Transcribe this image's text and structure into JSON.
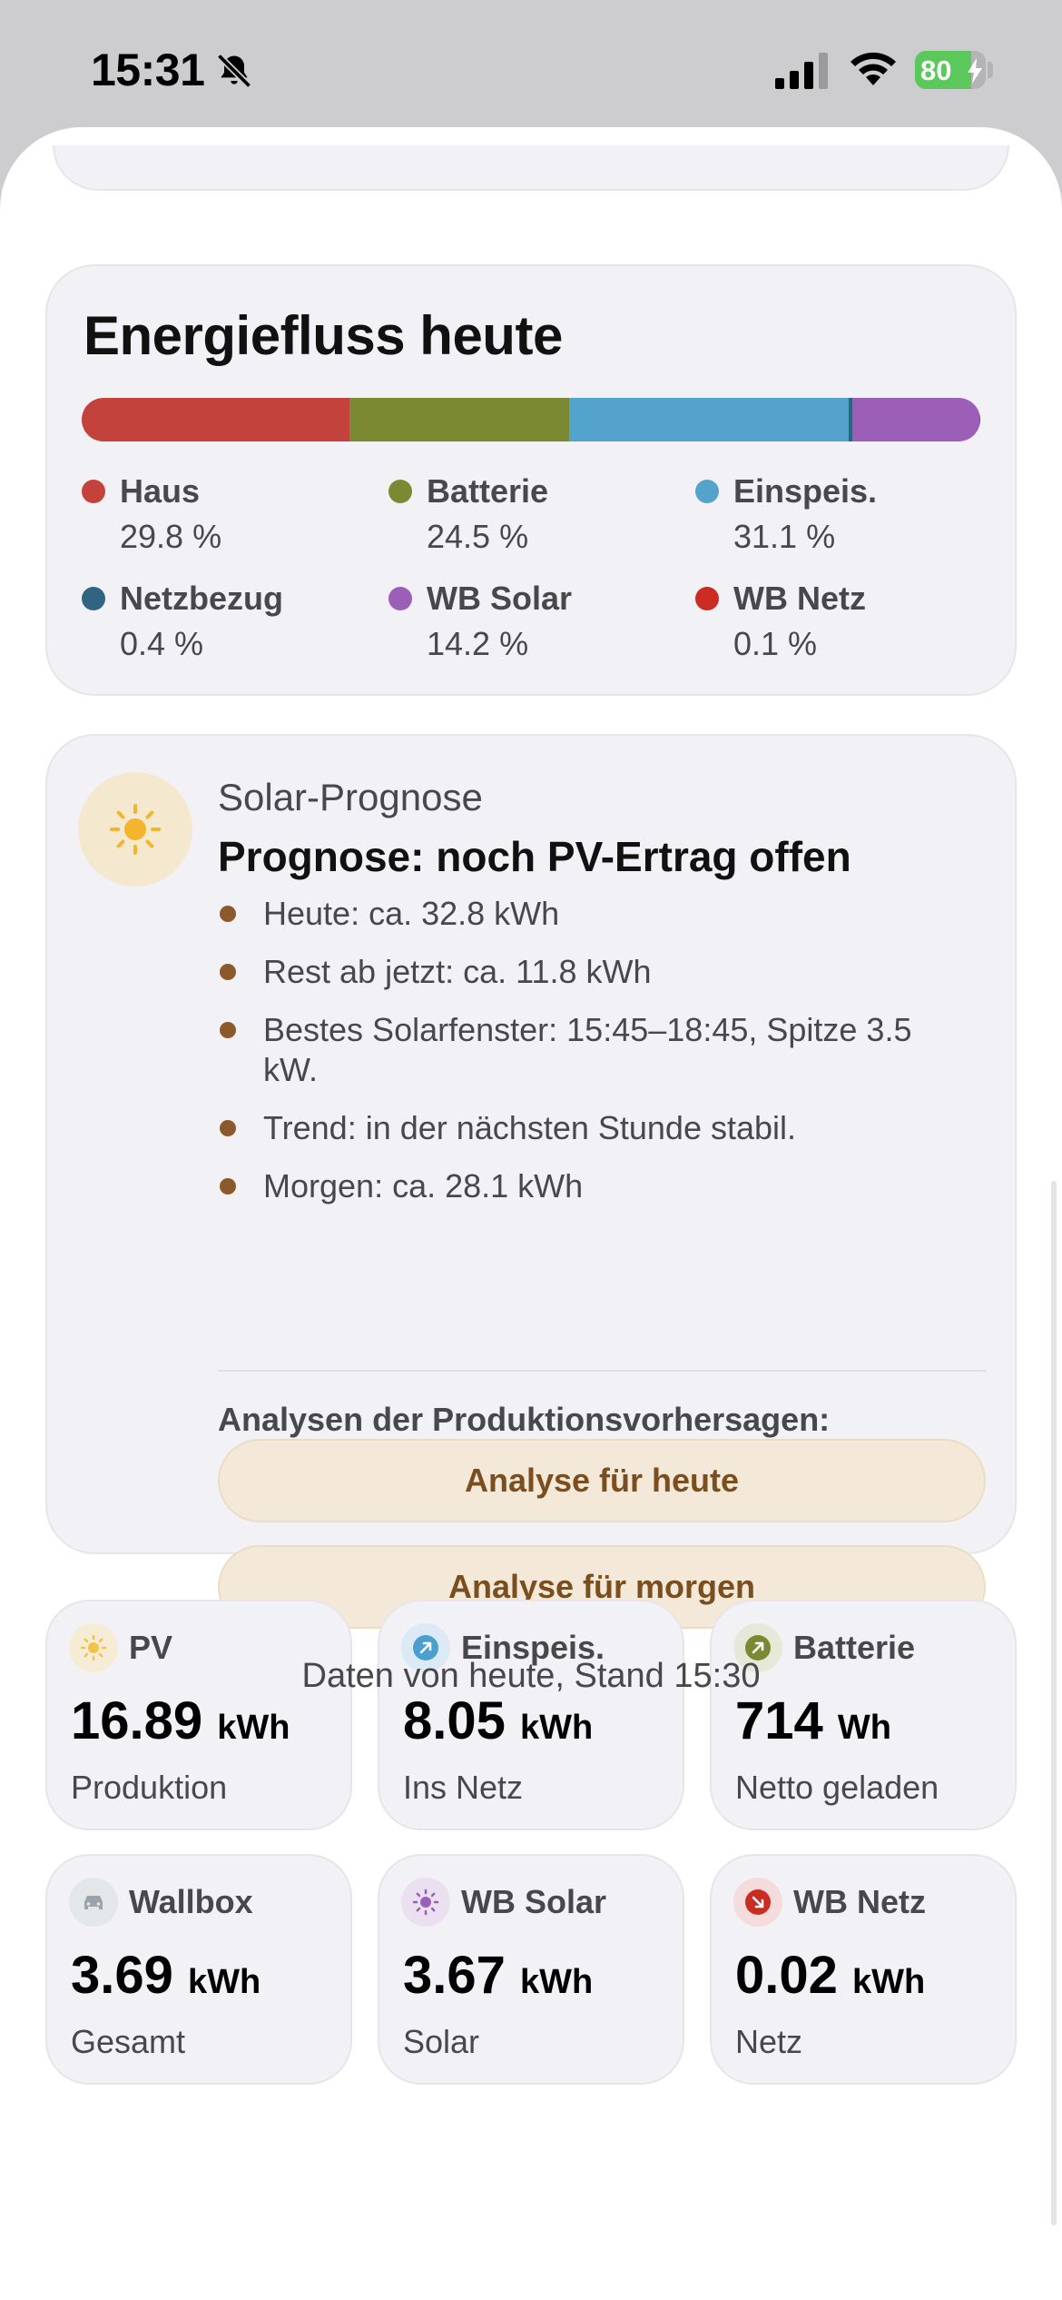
{
  "status_bar": {
    "time": "15:31",
    "battery_level": "80",
    "battery_fraction": 0.8
  },
  "energy_flow": {
    "title": "Energiefluss heute",
    "segments": [
      {
        "name": "Haus",
        "value": "29.8 %",
        "fraction": 0.298,
        "color": "#c4423c"
      },
      {
        "name": "Batterie",
        "value": "24.5 %",
        "fraction": 0.245,
        "color": "#7b8a32"
      },
      {
        "name": "Einspeis.",
        "value": "31.1 %",
        "fraction": 0.311,
        "color": "#54a3cc"
      },
      {
        "name": "Netzbezug",
        "value": "0.4 %",
        "fraction": 0.004,
        "color": "#2f6580"
      },
      {
        "name": "WB Solar",
        "value": "14.2 %",
        "fraction": 0.142,
        "color": "#9b5fb8"
      },
      {
        "name": "WB Netz",
        "value": "0.1 %",
        "fraction": 0.001,
        "color": "#cc2b24"
      }
    ]
  },
  "forecast": {
    "icon": "sun-icon",
    "label": "Solar-Prognose",
    "headline": "Prognose: noch PV-Ertrag offen",
    "bullets": [
      "Heute: ca. 32.8 kWh",
      "Rest ab jetzt: ca. 11.8 kWh",
      "Bestes Solarfenster: 15:45–18:45, Spitze 3.5 kW.",
      "Trend: in der nächsten Stunde stabil.",
      "Morgen: ca. 28.1 kWh"
    ],
    "analysis_heading": "Analysen der Produktionsvorhersagen:",
    "button_today": "Analyse für heute",
    "button_tomorrow": "Analyse für morgen"
  },
  "tiles": [
    {
      "title": "PV",
      "value": "16.89",
      "unit": "kWh",
      "subtitle": "Produktion",
      "icon": "sun-icon",
      "icon_bg": "#f6ecd6",
      "icon_color": "#f2c24a"
    },
    {
      "title": "Einspeis.",
      "value": "8.05",
      "unit": "kWh",
      "subtitle": "Ins Netz",
      "icon": "arrow-up-right-icon",
      "icon_bg": "#dbeaf4",
      "icon_color": "#4a9fd0"
    },
    {
      "title": "Batterie",
      "value": "714",
      "unit": "Wh",
      "subtitle": "Netto geladen",
      "icon": "arrow-up-right-icon",
      "icon_bg": "#e6e9d8",
      "icon_color": "#7b8a32"
    },
    {
      "title": "Wallbox",
      "value": "3.69",
      "unit": "kWh",
      "subtitle": "Gesamt",
      "icon": "car-icon",
      "icon_bg": "#e4e7ea",
      "icon_color": "#9aa4ac"
    },
    {
      "title": "WB Solar",
      "value": "3.67",
      "unit": "kWh",
      "subtitle": "Solar",
      "icon": "sun-icon",
      "icon_bg": "#ebe0f0",
      "icon_color": "#9b5fb8"
    },
    {
      "title": "WB Netz",
      "value": "0.02",
      "unit": "kWh",
      "subtitle": "Netz",
      "icon": "arrow-down-right-icon",
      "icon_bg": "#f4dcdc",
      "icon_color": "#cc2b24"
    }
  ],
  "footer": "Daten von heute, Stand 15:30"
}
